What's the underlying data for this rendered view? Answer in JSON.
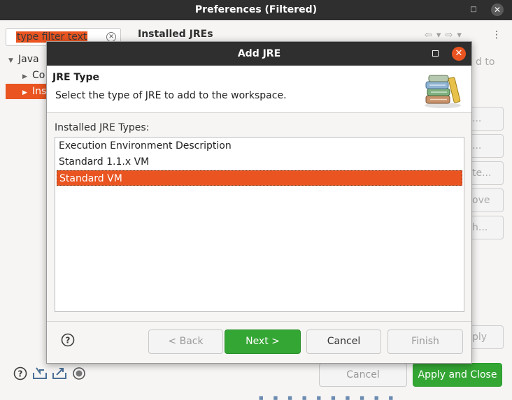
{
  "preferences_window": {
    "title": "Preferences (Filtered)",
    "filter": {
      "value": "type filter text"
    },
    "tree": [
      {
        "label": "Java",
        "expanded": true,
        "selected": false
      },
      {
        "label": "Co",
        "expanded": false,
        "selected": false
      },
      {
        "label": "Ins",
        "expanded": false,
        "selected": true
      }
    ],
    "page_heading": "Installed JREs",
    "partial_text": "d to",
    "side_buttons": [
      "...",
      "...",
      "te...",
      "ove",
      "h..."
    ],
    "apply_partial": "ply",
    "buttons": {
      "cancel": "Cancel",
      "apply_and_close": "Apply and Close"
    }
  },
  "dialog": {
    "title": "Add JRE",
    "banner": {
      "title": "JRE Type",
      "description": "Select the type of JRE to add to the workspace."
    },
    "list_label": "Installed JRE Types:",
    "jre_types": [
      {
        "label": "Execution Environment Description",
        "selected": false
      },
      {
        "label": "Standard 1.1.x VM",
        "selected": false
      },
      {
        "label": "Standard VM",
        "selected": true
      }
    ],
    "buttons": {
      "back": "< Back",
      "next": "Next >",
      "cancel": "Cancel",
      "finish": "Finish"
    }
  },
  "colors": {
    "accent_orange": "#e95420",
    "primary_green": "#34a634",
    "titlebar_dark": "#2f2f2f"
  },
  "icons": [
    "help-icon",
    "import-icon",
    "export-icon",
    "record-icon",
    "jre-library-icon",
    "close-icon",
    "maximize-icon",
    "back-arrow-icon",
    "forward-arrow-icon",
    "menu-icon"
  ]
}
